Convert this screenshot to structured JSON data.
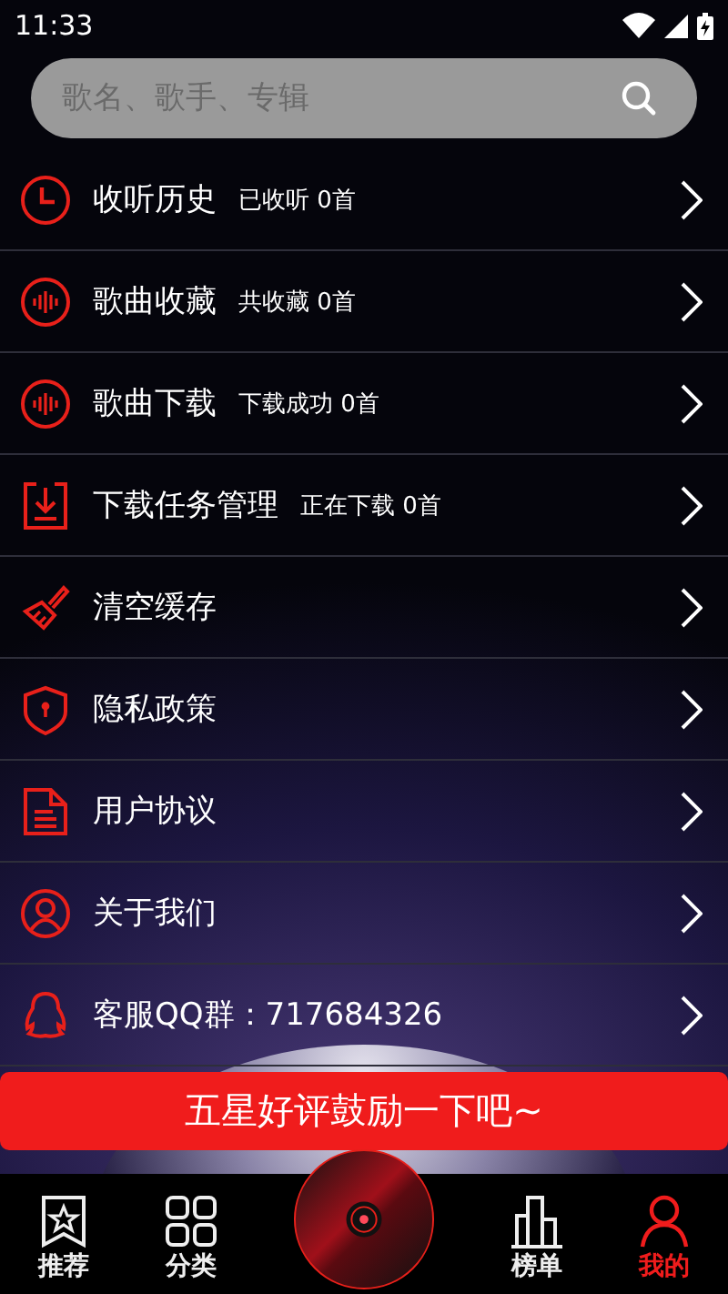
{
  "status_bar": {
    "time": "11:33"
  },
  "search": {
    "placeholder": "歌名、歌手、专辑"
  },
  "menu": [
    {
      "kind": "clock",
      "title": "收听历史",
      "subtitle": "已收听 0首"
    },
    {
      "kind": "wave",
      "title": "歌曲收藏",
      "subtitle": "共收藏 0首"
    },
    {
      "kind": "wave",
      "title": "歌曲下载",
      "subtitle": "下载成功 0首"
    },
    {
      "kind": "download",
      "title": "下载任务管理",
      "subtitle": "正在下载 0首"
    },
    {
      "kind": "brush",
      "title": "清空缓存"
    },
    {
      "kind": "shield",
      "title": "隐私政策"
    },
    {
      "kind": "document",
      "title": "用户协议"
    },
    {
      "kind": "person",
      "title": "关于我们"
    },
    {
      "kind": "qq",
      "title": "客服QQ群：717684326"
    }
  ],
  "rate_button": "五星好评鼓励一下吧~",
  "tabs": [
    {
      "kind": "bookmark",
      "label": "推荐",
      "selected": false
    },
    {
      "kind": "grid",
      "label": "分类",
      "selected": false
    },
    {
      "kind": "chart",
      "label": "榜单",
      "selected": false
    },
    {
      "kind": "user",
      "label": "我的",
      "selected": true
    }
  ]
}
